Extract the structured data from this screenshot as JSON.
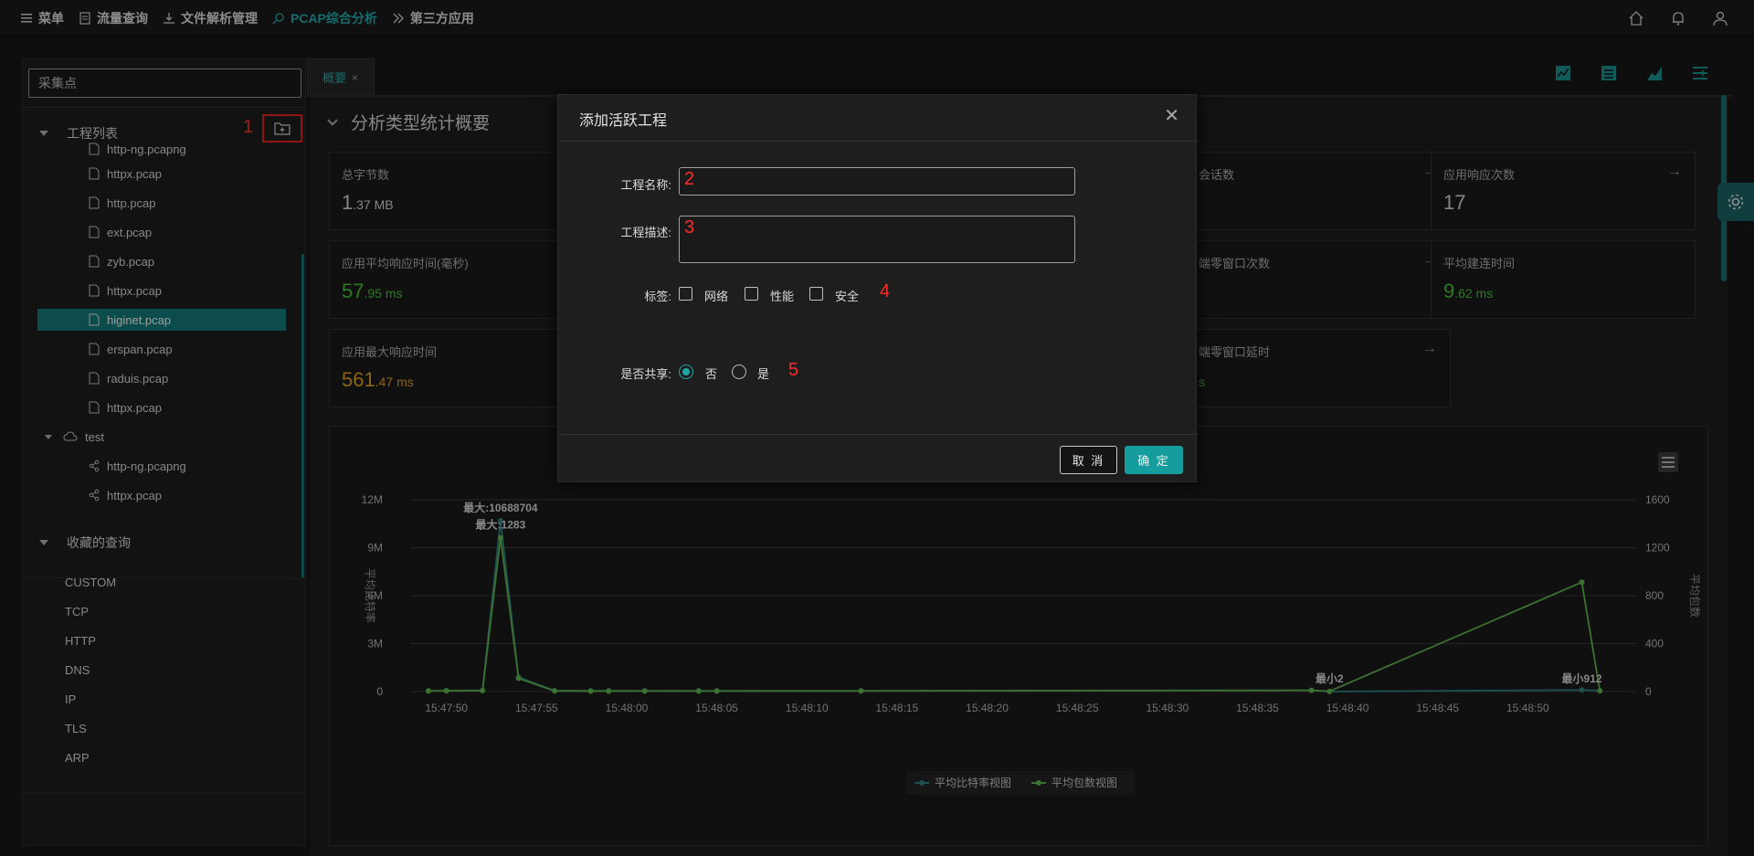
{
  "topnav": {
    "items": [
      {
        "label": "菜单",
        "icon": "menu-icon"
      },
      {
        "label": "流量查询",
        "icon": "document-icon"
      },
      {
        "label": "文件解析管理",
        "icon": "download-icon"
      },
      {
        "label": "PCAP综合分析",
        "icon": "search-icon"
      },
      {
        "label": "第三方应用",
        "icon": "double-chevron-icon"
      }
    ],
    "right_icons": [
      "home-icon",
      "bell-icon",
      "user-icon"
    ]
  },
  "left": {
    "search_placeholder": "采集点",
    "project_list_title": "工程列表",
    "files": [
      "http-ng.pcapng",
      "httpx.pcap",
      "http.pcap",
      "ext.pcap",
      "zyb.pcap",
      "httpx.pcap",
      "higinet.pcap",
      "erspan.pcap",
      "raduis.pcap",
      "httpx.pcap"
    ],
    "selected_file": "higinet.pcap",
    "test_node": "test",
    "test_files": [
      "http-ng.pcapng",
      "httpx.pcap"
    ],
    "favorites_title": "收藏的查询",
    "favorites": [
      "CUSTOM",
      "TCP",
      "HTTP",
      "DNS",
      "IP",
      "TLS",
      "ARP"
    ]
  },
  "annotations": {
    "a1": "1",
    "a2": "2",
    "a3": "3",
    "a4": "4",
    "a5": "5"
  },
  "tab": {
    "label": "概要",
    "close": "×"
  },
  "section": {
    "title": "分析类型统计概要"
  },
  "cards": [
    {
      "label": "总字节数",
      "int": "1",
      "dec": ".37 MB"
    },
    {
      "label": "会话数",
      "int": "",
      "dec": ""
    },
    {
      "label": "应用响应次数",
      "int": "17",
      "dec": ""
    },
    {
      "label": "应用平均响应时间(毫秒)",
      "int": "57",
      "dec": ".95 ms"
    },
    {
      "label": "端零窗口次数",
      "int": "",
      "dec": ""
    },
    {
      "label": "平均建连时间",
      "int": "9",
      "dec": ".62 ms"
    },
    {
      "label": "应用最大响应时间",
      "int": "561",
      "dec": ".47 ms"
    },
    {
      "label": "端零窗口延时",
      "int": "",
      "dec": "s"
    }
  ],
  "dialog": {
    "title": "添加活跃工程",
    "name_label": "工程名称:",
    "name_value": "",
    "desc_label": "工程描述:",
    "desc_value": "",
    "tags_label": "标签:",
    "tags": [
      "网络",
      "性能",
      "安全"
    ],
    "share_label": "是否共享:",
    "share_options": [
      "否",
      "是"
    ],
    "share_selected": "否",
    "cancel": "取 消",
    "ok": "确 定"
  },
  "chart_data": {
    "type": "line",
    "x": [
      "15:47:49",
      "15:47:50",
      "15:47:52",
      "15:47:53",
      "15:47:54",
      "15:47:56",
      "15:47:58",
      "15:47:59",
      "15:48:01",
      "15:48:04",
      "15:48:05",
      "15:48:13",
      "15:48:38",
      "15:48:39",
      "15:48:53",
      "15:48:54"
    ],
    "xticks": [
      "15:47:50",
      "15:47:55",
      "15:48:00",
      "15:48:05",
      "15:48:10",
      "15:48:15",
      "15:48:20",
      "15:48:25",
      "15:48:30",
      "15:48:35",
      "15:48:40",
      "15:48:45",
      "15:48:50"
    ],
    "series": [
      {
        "name": "平均比特率视图",
        "axis": "left",
        "color": "#2e7d7d",
        "values": [
          50000,
          60000,
          80000,
          10688704,
          900000,
          60000,
          50000,
          50000,
          50000,
          50000,
          50000,
          50000,
          80000,
          2,
          100000,
          60000
        ]
      },
      {
        "name": "平均包数视图",
        "axis": "right",
        "color": "#5fae4e",
        "values": [
          5,
          6,
          8,
          1283,
          110,
          5,
          4,
          4,
          4,
          4,
          4,
          5,
          10,
          2,
          912,
          6
        ]
      }
    ],
    "left_axis": {
      "label": "平均比特率",
      "ticks": [
        "0",
        "3M",
        "6M",
        "9M",
        "12M"
      ],
      "max": 12000000
    },
    "right_axis": {
      "label": "平均包数",
      "ticks": [
        "0",
        "400",
        "800",
        "1200",
        "1600"
      ],
      "max": 1600
    },
    "annotations": [
      "最大:10688704",
      "最大:1283",
      "最小2",
      "最小912"
    ],
    "legend_position": "bottom",
    "grid": true
  }
}
